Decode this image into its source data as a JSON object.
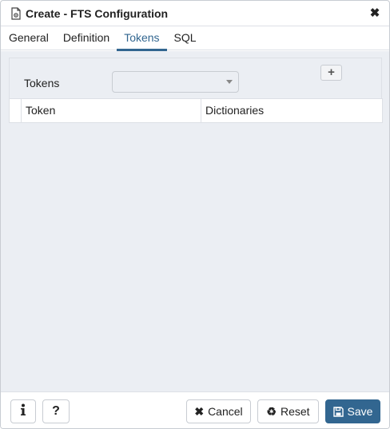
{
  "dialog": {
    "title": "Create - FTS Configuration",
    "close_icon": "close-icon"
  },
  "tabs": [
    {
      "label": "General",
      "active": false
    },
    {
      "label": "Definition",
      "active": false
    },
    {
      "label": "Tokens",
      "active": true
    },
    {
      "label": "SQL",
      "active": false
    }
  ],
  "tokens": {
    "label": "Tokens",
    "selected_value": "",
    "add_icon": "plus-icon"
  },
  "grid": {
    "columns": [
      "Token",
      "Dictionaries"
    ],
    "rows": []
  },
  "footer": {
    "info_icon": "info-icon",
    "help_icon": "help-icon",
    "cancel_label": "Cancel",
    "reset_label": "Reset",
    "save_label": "Save"
  },
  "colors": {
    "accent": "#326690",
    "content_bg": "#ebeef3",
    "border": "#dde0e6"
  }
}
